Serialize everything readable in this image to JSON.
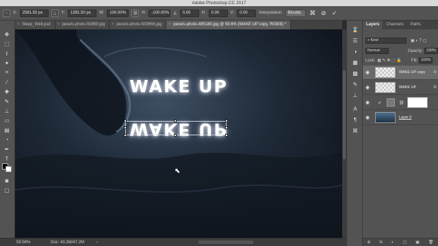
{
  "window": {
    "title": "Adobe Photoshop CC 2017"
  },
  "options_bar": {
    "x_label": "X:",
    "x_value": "2581.50 px",
    "delta_icon": "delta-icon",
    "y_label": "Y:",
    "y_value": "1391.50 px",
    "w_label": "W:",
    "w_value": "100.00%",
    "link_icon": "link-icon",
    "h_label": "H:",
    "h_value": "-100.00%",
    "angle_value": "0.00",
    "hskew_label": "H:",
    "hskew_value": "0.00",
    "vskew_label": "V:",
    "vskew_value": "0.00",
    "interpolation_label": "Interpolation:",
    "interpolation_value": "Bicubic",
    "cancel_symbol": "⊘",
    "commit_symbol": "✓"
  },
  "tabs": [
    {
      "label": "Sleep_Well.psd"
    },
    {
      "label": "pexels-photo-50859.jpg"
    },
    {
      "label": "pexels-photo-509656.jpg"
    },
    {
      "label": "pexels-photo-485180.jpg @ 59.6% (WAKE UP copy, RGB/8) *"
    }
  ],
  "canvas": {
    "caption_top": "WAKE UP",
    "caption_reflection": "WAKE UP"
  },
  "status_bar": {
    "zoom": "59.56%",
    "doc": "Doc: 43.2M/47.2M",
    "arrow": "›"
  },
  "layers_panel": {
    "tabs": [
      "Layers",
      "Channels",
      "Paths"
    ],
    "filter_label": "Kind",
    "blend_mode": "Normal",
    "opacity_label": "Opacity:",
    "opacity_value": "100%",
    "lock_label": "Lock:",
    "fill_label": "Fill:",
    "fill_value": "100%",
    "layers": [
      {
        "name": "WAKE UP copy",
        "fx": "fx"
      },
      {
        "name": "WAKE UP",
        "fx": "fx"
      },
      {
        "name": ""
      },
      {
        "name": "Layer 0"
      }
    ],
    "footer_items": [
      "⊕",
      "fx",
      "◐",
      "▢",
      "▣",
      "🗑"
    ]
  },
  "colors": {
    "accent_selected_layer": "#6a6a6a",
    "canvas_dark": "#141a22"
  }
}
